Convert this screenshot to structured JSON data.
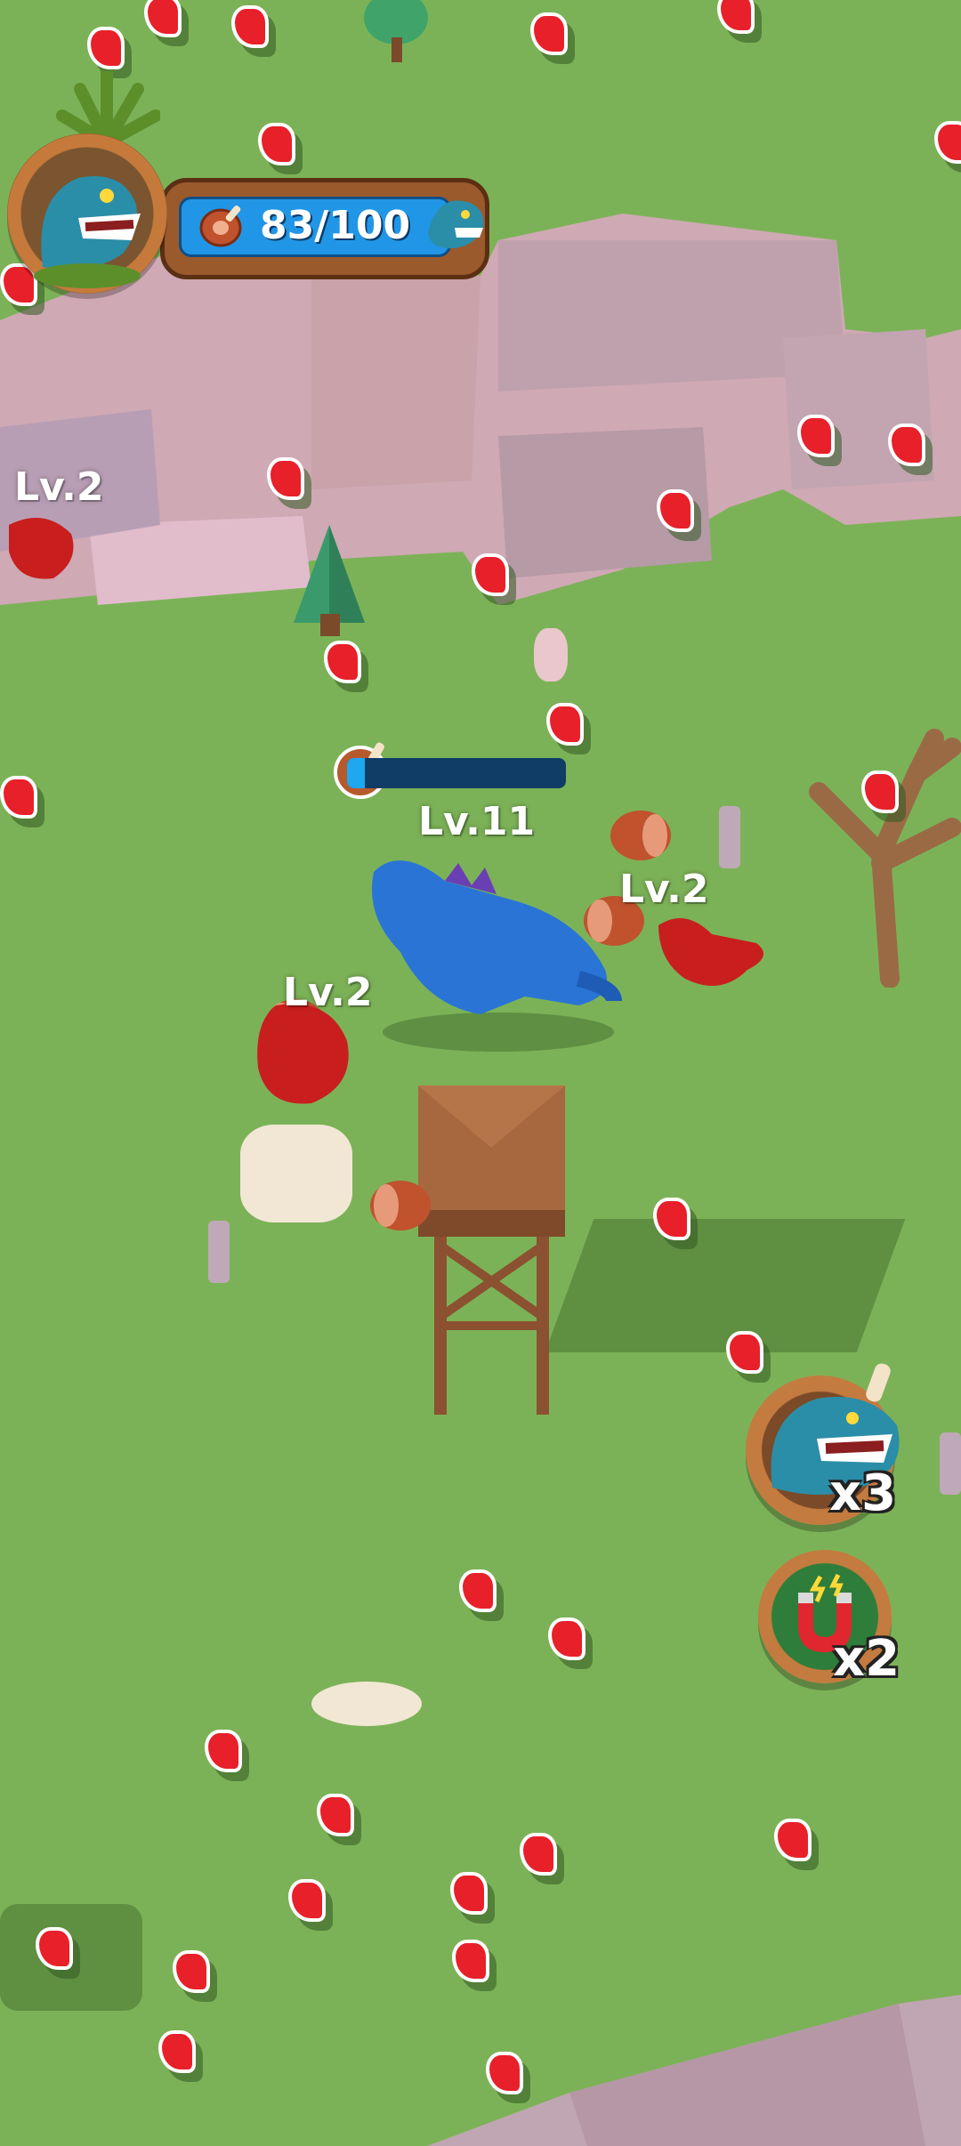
{
  "hud": {
    "food_counter": "83/100",
    "food_progress": 0.83,
    "portrait_icon": "blue-dinosaur-portrait-icon",
    "food_icon": "meat-icon",
    "evolution_icon": "next-dinosaur-icon"
  },
  "player": {
    "level_label": "Lv.11",
    "xp_progress": 0.08,
    "xp_icon": "meat-icon"
  },
  "enemies": [
    {
      "name": "enemy-red-dino-topleft",
      "level_label": "Lv.2"
    },
    {
      "name": "enemy-red-dino-right",
      "level_label": "Lv.2"
    },
    {
      "name": "enemy-red-dino-left",
      "level_label": "Lv.2"
    }
  ],
  "powerups": [
    {
      "name": "dinosaur-power",
      "icon": "dinosaur-head-icon",
      "count": "x3",
      "color": "#b4622e"
    },
    {
      "name": "magnet-power",
      "icon": "magnet-icon",
      "count": "x2",
      "color": "#2f7d3a"
    }
  ],
  "colors": {
    "grass": "#7cb257",
    "meat": "#e8202a",
    "player_dino": "#2a74d6",
    "enemy_dino": "#c81e1e",
    "hud_wood": "#9b5a2c",
    "hud_blue": "#2196e6"
  }
}
